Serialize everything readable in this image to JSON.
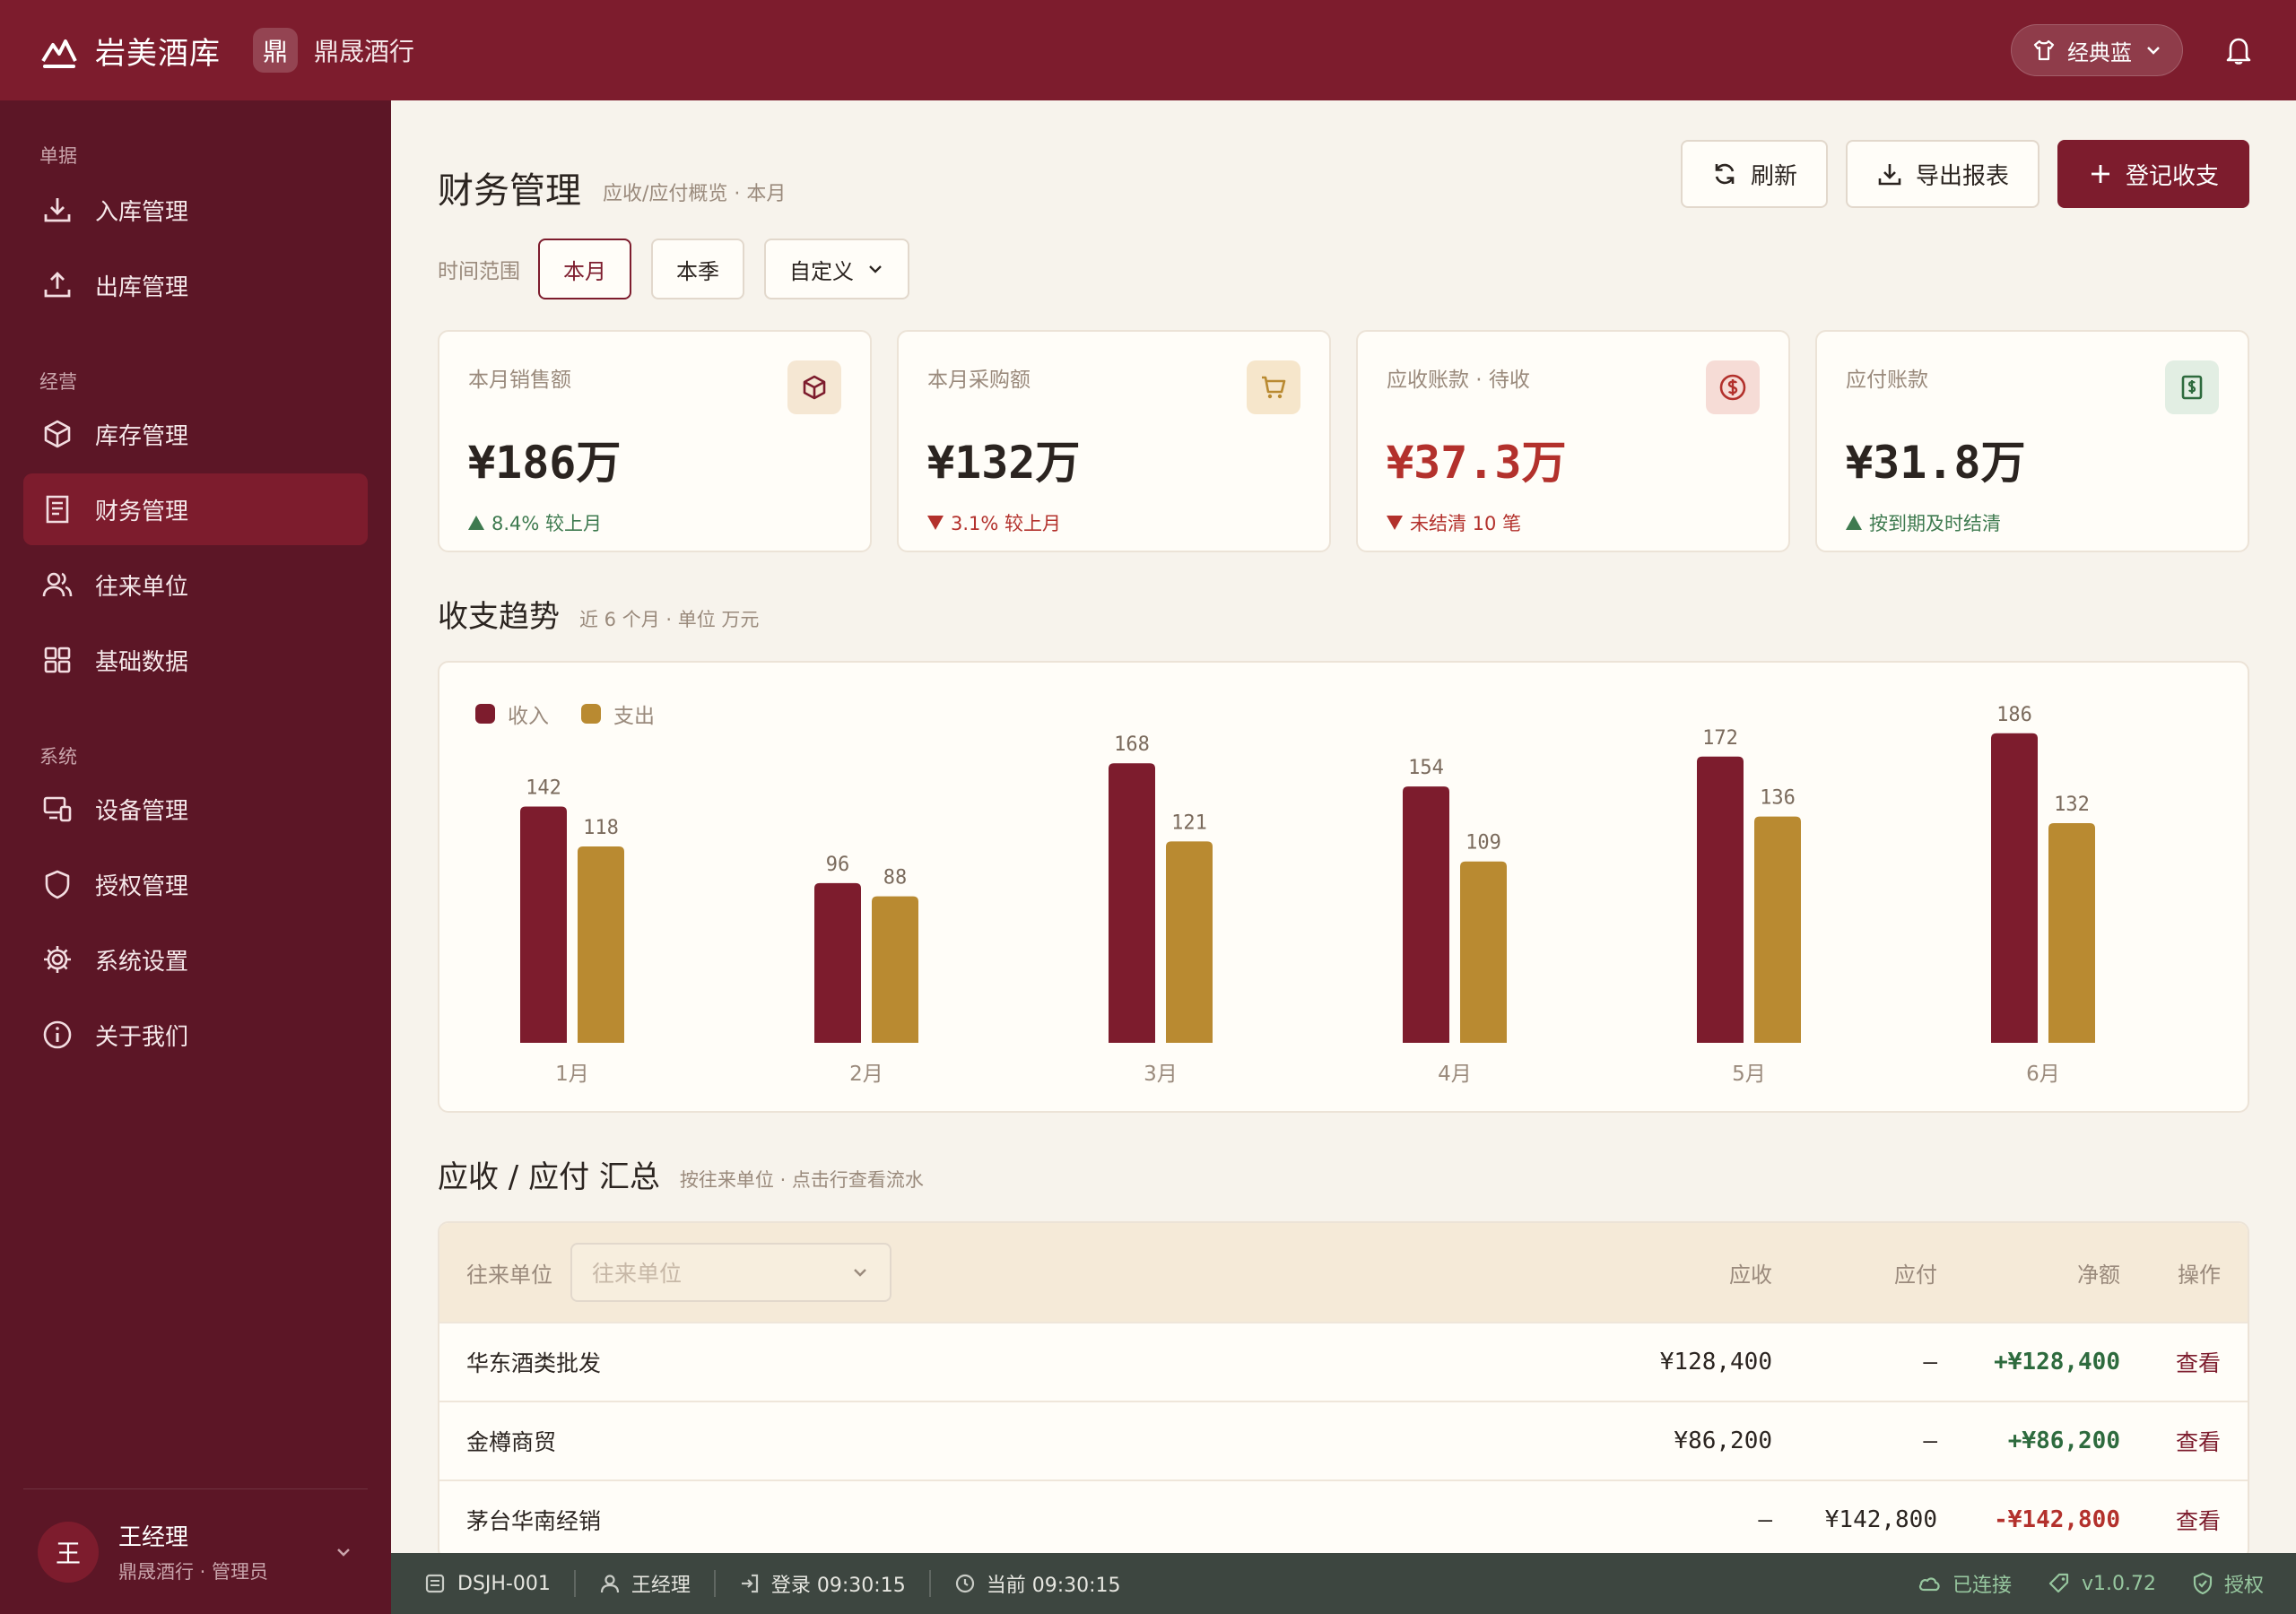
{
  "app": {
    "name": "岩美酒库",
    "shop_badge": "鼎",
    "shop_name": "鼎晟酒行",
    "theme": "经典蓝"
  },
  "sidebar": {
    "groups": [
      {
        "label": "单据",
        "items": [
          {
            "label": "入库管理"
          },
          {
            "label": "出库管理"
          }
        ]
      },
      {
        "label": "经营",
        "items": [
          {
            "label": "库存管理"
          },
          {
            "label": "财务管理"
          },
          {
            "label": "往来单位"
          },
          {
            "label": "基础数据"
          }
        ]
      },
      {
        "label": "系统",
        "items": [
          {
            "label": "设备管理"
          },
          {
            "label": "授权管理"
          },
          {
            "label": "系统设置"
          },
          {
            "label": "关于我们"
          }
        ]
      }
    ],
    "user": {
      "avatar": "王",
      "name": "王经理",
      "meta": "鼎晟酒行 · 管理员"
    }
  },
  "page": {
    "title": "财务管理",
    "subtitle": "应收/应付概览 · 本月",
    "actions": {
      "refresh": "刷新",
      "export": "导出报表",
      "record": "登记收支"
    },
    "range": {
      "label": "时间范围",
      "month": "本月",
      "quarter": "本季",
      "custom": "自定义"
    }
  },
  "kpis": [
    {
      "label": "本月销售额",
      "value": "¥186万",
      "trend": "8.4% 较上月",
      "dir": "up"
    },
    {
      "label": "本月采购额",
      "value": "¥132万",
      "trend": "3.1% 较上月",
      "dir": "down"
    },
    {
      "label": "应收账款 · 待收",
      "value": "¥37.3万",
      "trend": "未结清 10 笔",
      "dir": "down"
    },
    {
      "label": "应付账款",
      "value": "¥31.8万",
      "trend": "按到期及时结清",
      "dir": "up"
    }
  ],
  "trend_section": {
    "title": "收支趋势",
    "subtitle": "近 6 个月 · 单位 万元"
  },
  "chart_data": {
    "type": "bar",
    "categories": [
      "1月",
      "2月",
      "3月",
      "4月",
      "5月",
      "6月"
    ],
    "series": [
      {
        "name": "收入",
        "values": [
          142,
          96,
          168,
          154,
          172,
          186
        ],
        "color": "#7d1c2d"
      },
      {
        "name": "支出",
        "values": [
          118,
          88,
          121,
          109,
          136,
          132
        ],
        "color": "#b98a31"
      }
    ],
    "ylim": [
      0,
      200
    ],
    "grid": false,
    "legend": "top-left"
  },
  "summary_section": {
    "title": "应收 / 应付 汇总",
    "subtitle": "按往来单位 · 点击行查看流水"
  },
  "table": {
    "filter_label": "往来单位",
    "filter_placeholder": "往来单位",
    "headers": {
      "ar": "应收",
      "ap": "应付",
      "net": "净额",
      "op": "操作"
    },
    "rows": [
      {
        "name": "华东酒类批发",
        "ar": "¥128,400",
        "ap": "—",
        "net": "+¥128,400",
        "op": "查看"
      },
      {
        "name": "金樽商贸",
        "ar": "¥86,200",
        "ap": "—",
        "net": "+¥86,200",
        "op": "查看"
      },
      {
        "name": "茅台华南经销",
        "ar": "—",
        "ap": "¥142,800",
        "net": "-¥142,800",
        "op": "查看"
      }
    ]
  },
  "status": {
    "device": "DSJH-001",
    "user": "王经理",
    "login": "登录 09:30:15",
    "now": "当前 09:30:15",
    "connection": "已连接",
    "version": "v1.0.72",
    "license": "授权"
  }
}
